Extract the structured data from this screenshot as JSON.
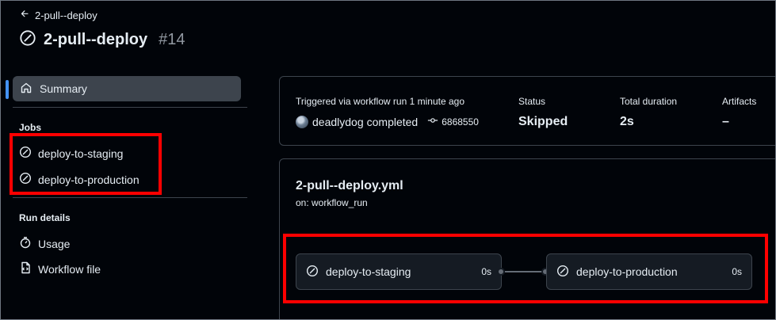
{
  "header": {
    "back_label": "2-pull--deploy",
    "workflow_name": "2-pull--deploy",
    "run_number": "#14"
  },
  "sidebar": {
    "summary_label": "Summary",
    "jobs_title": "Jobs",
    "jobs": [
      {
        "label": "deploy-to-staging",
        "status_icon": "skipped-icon"
      },
      {
        "label": "deploy-to-production",
        "status_icon": "skipped-icon"
      }
    ],
    "run_details_title": "Run details",
    "usage_label": "Usage",
    "workflow_file_label": "Workflow file"
  },
  "summary": {
    "trigger_label": "Triggered via workflow run 1 minute ago",
    "actor": "deadlydog",
    "trigger_action": "completed",
    "commit": "6868550",
    "status_label": "Status",
    "status_value": "Skipped",
    "duration_label": "Total duration",
    "duration_value": "2s",
    "artifacts_label": "Artifacts",
    "artifacts_value": "–"
  },
  "graph": {
    "file_name": "2-pull--deploy.yml",
    "trigger": "on: workflow_run",
    "jobs": [
      {
        "label": "deploy-to-staging",
        "duration": "0s"
      },
      {
        "label": "deploy-to-production",
        "duration": "0s"
      }
    ]
  },
  "colors": {
    "background": "#010409",
    "accent": "#4493f8",
    "highlight": "#ff0000",
    "panel_border": "#3d444d"
  }
}
